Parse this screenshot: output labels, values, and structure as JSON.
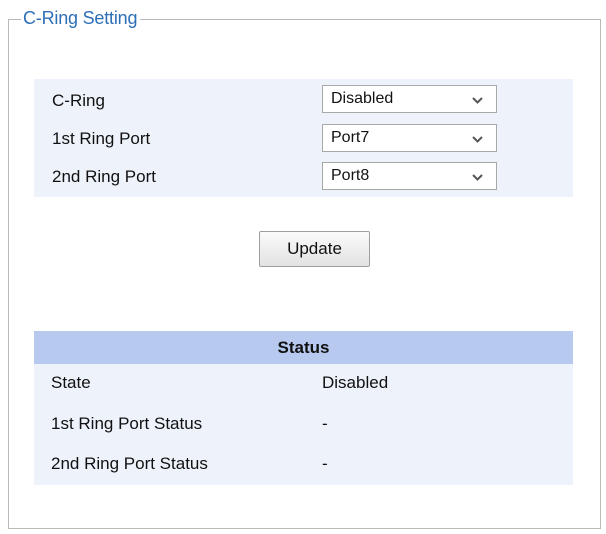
{
  "panel": {
    "title": "C-Ring Setting"
  },
  "settings": {
    "rows": [
      {
        "label": "C-Ring",
        "value": "Disabled"
      },
      {
        "label": "1st Ring Port",
        "value": "Port7"
      },
      {
        "label": "2nd Ring Port",
        "value": "Port8"
      }
    ],
    "update_label": "Update"
  },
  "status": {
    "header": "Status",
    "rows": [
      {
        "label": "State",
        "value": "Disabled"
      },
      {
        "label": "1st Ring Port Status",
        "value": "-"
      },
      {
        "label": "2nd Ring Port Status",
        "value": "-"
      }
    ]
  },
  "icons": {
    "dropdown": "chevron-down-icon"
  },
  "colors": {
    "title": "#2d6fb7",
    "settings_background": "#eef2fb",
    "status_header_background": "#b7c9ef",
    "border": "#b9b9b9"
  }
}
